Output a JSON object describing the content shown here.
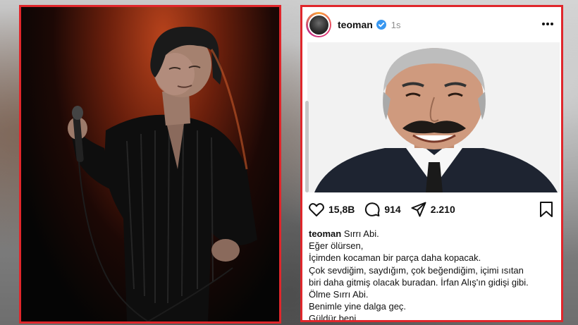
{
  "post": {
    "username": "teoman",
    "verified": true,
    "time": "1s",
    "likes": "15,8B",
    "comments": "914",
    "shares": "2.210",
    "caption": {
      "first_line": "Sırrı Abi.",
      "lines": [
        "Eğer ölürsen,",
        "İçimden kocaman bir parça daha kopacak.",
        "Çok sevdiğim, saydığım, çok beğendiğim, içimi ısıtan",
        "biri daha gitmiş olacak buradan. İrfan Alış'ın gidişi gibi.",
        "Ölme Sırrı Abi.",
        "Benimle yine dalga geç.",
        "Güldür beni."
      ]
    }
  },
  "colors": {
    "frame": "#e0262b",
    "verified_blue": "#3897f0",
    "text": "#111111",
    "muted": "#8e8e8e"
  },
  "icons": {
    "like": "heart-icon",
    "comment": "comment-icon",
    "share": "paper-plane-icon",
    "save": "bookmark-icon",
    "more": "more-dots-icon",
    "verified": "verified-badge-icon"
  }
}
